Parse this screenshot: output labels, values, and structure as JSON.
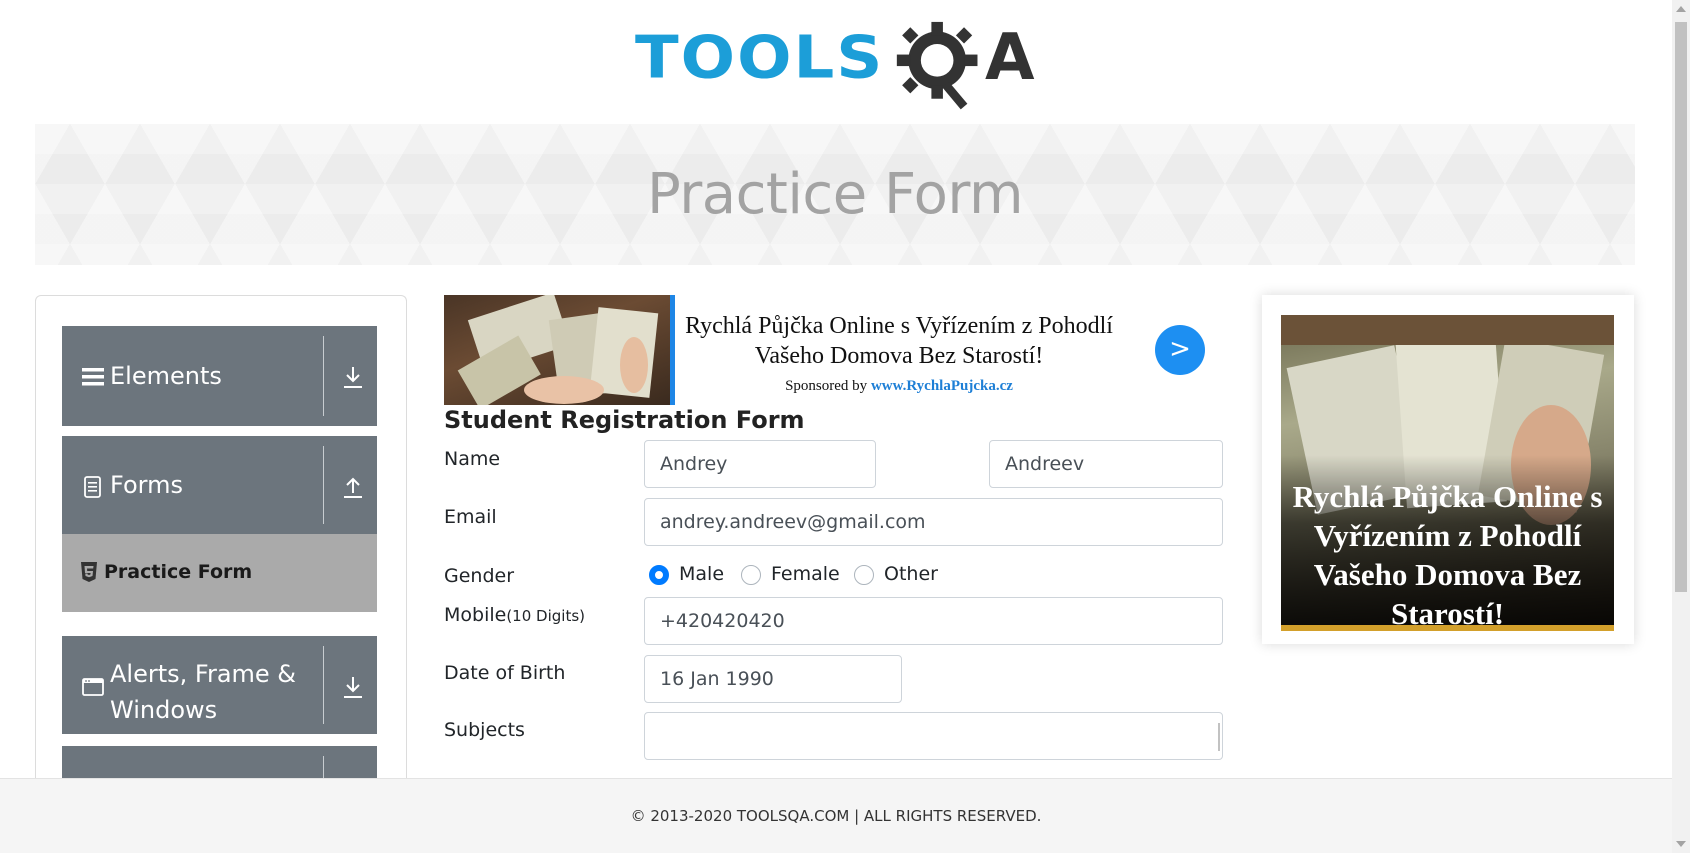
{
  "logo": {
    "part1": "TOOLS",
    "part2": "A"
  },
  "banner": {
    "title": "Practice Form"
  },
  "sidebar": {
    "groups": [
      {
        "label": "Elements",
        "icon": "list-icon",
        "state": "collapsed"
      },
      {
        "label": "Forms",
        "icon": "document-icon",
        "state": "expanded"
      },
      {
        "label": "Alerts, Frame & Windows",
        "icon": "window-icon",
        "state": "collapsed"
      },
      {
        "label": "",
        "icon": "",
        "state": "collapsed"
      }
    ],
    "active_item": {
      "label": "Practice Form",
      "icon": "html5-icon"
    }
  },
  "ad_top": {
    "headline": "Rychlá Půjčka Online s Vyřízením z Pohodlí Vašeho Domova Bez Starostí!",
    "sponsored_prefix": "Sponsored by",
    "sponsored_url": "www.RychlaPujcka.cz",
    "go_label": ">"
  },
  "form": {
    "title": "Student Registration Form",
    "name_label": "Name",
    "first_name": "Andrey",
    "last_name": "Andreev",
    "email_label": "Email",
    "email": "andrey.andreev@gmail.com",
    "gender_label": "Gender",
    "gender_options": [
      "Male",
      "Female",
      "Other"
    ],
    "gender_selected": "Male",
    "mobile_label": "Mobile",
    "mobile_hint": "(10 Digits)",
    "mobile": "+420420420",
    "dob_label": "Date of Birth",
    "dob": "16 Jan 1990",
    "subjects_label": "Subjects",
    "subjects": ""
  },
  "ad_right": {
    "headline": "Rychlá Půjčka Online s Vyřízením z Pohodlí Vašeho Domova Bez Starostí!"
  },
  "footer": {
    "text": "© 2013-2020 TOOLSQA.COM | ALL RIGHTS RESERVED."
  },
  "colors": {
    "accent": "#007bff",
    "sidebar_group": "#6c757d",
    "sidebar_active": "#aaaaaa",
    "logo_blue": "#1c9ed8"
  }
}
